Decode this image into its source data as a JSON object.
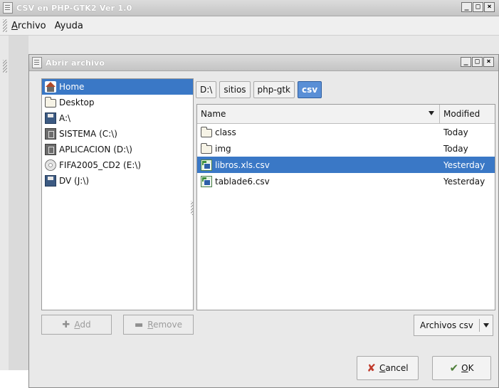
{
  "main_window": {
    "title": "CSV en PHP-GTK2 Ver 1.0",
    "controls": [
      "_",
      "□",
      "×"
    ],
    "menu": [
      {
        "mnemonic": "A",
        "rest": "rchivo"
      },
      {
        "mnemonic": "",
        "rest": "Ayuda"
      }
    ]
  },
  "dialog": {
    "title": "Abrir archivo",
    "controls": [
      "_",
      "□",
      "×"
    ],
    "places": [
      {
        "label": "Home",
        "icon": "home-icon",
        "selected": true
      },
      {
        "label": "Desktop",
        "icon": "folder-icon"
      },
      {
        "label": "A:\\",
        "icon": "floppy-icon"
      },
      {
        "label": "SISTEMA (C:\\)",
        "icon": "hard-disk-icon"
      },
      {
        "label": "APLICACION (D:\\)",
        "icon": "hard-disk-icon"
      },
      {
        "label": "FIFA2005_CD2 (E:\\)",
        "icon": "cdrom-icon"
      },
      {
        "label": "DV (J:\\)",
        "icon": "floppy-icon"
      }
    ],
    "add_button": {
      "mnemonic": "A",
      "rest": "dd"
    },
    "remove_button": {
      "mnemonic": "R",
      "rest": "emove"
    },
    "path": [
      "D:\\",
      "sitios",
      "php-gtk",
      "csv"
    ],
    "columns": {
      "name": "Name",
      "modified": "Modified"
    },
    "files": [
      {
        "name": "class",
        "modified": "Today",
        "icon": "folder-icon"
      },
      {
        "name": "img",
        "modified": "Today",
        "icon": "folder-icon"
      },
      {
        "name": "libros.xls.csv",
        "modified": "Yesterday",
        "icon": "csv-file-icon",
        "selected": true
      },
      {
        "name": "tablade6.csv",
        "modified": "Yesterday",
        "icon": "csv-file-icon"
      }
    ],
    "filter": "Archivos csv",
    "cancel_button": {
      "mnemonic": "C",
      "rest": "ancel"
    },
    "ok_button": {
      "mnemonic": "O",
      "rest": "K"
    }
  },
  "colors": {
    "selection": "#3a78c6",
    "active_crumb": "#5a8fd6"
  }
}
